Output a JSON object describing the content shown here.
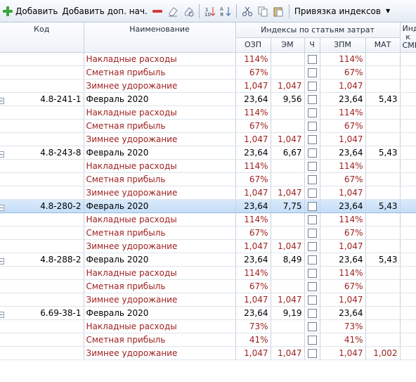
{
  "toolbar": {
    "add": "Добавить",
    "add_extra": "Добавить доп. нач.",
    "binding": "Привязка индексов"
  },
  "headers": {
    "code": "Код",
    "name": "Наименование",
    "group": "Индексы по статьям затрат",
    "ozp": "ОЗП",
    "em": "ЭМ",
    "ch": "Ч",
    "zpm": "ЗПМ",
    "mat": "МАТ",
    "cmr": "Индекс к СМР"
  },
  "rows": [
    {
      "type": "sub",
      "name": "Накладные расходы",
      "ozp": "114%",
      "em": "",
      "zpm": "114%",
      "mat": ""
    },
    {
      "type": "sub",
      "name": "Сметная прибыль",
      "ozp": "67%",
      "em": "",
      "zpm": "67%",
      "mat": ""
    },
    {
      "type": "sub",
      "name": "Зимнее удорожание",
      "ozp": "1,047",
      "em": "1,047",
      "zpm": "1,047",
      "mat": ""
    },
    {
      "type": "main",
      "code": "4.8-241-1",
      "name": "Февраль 2020",
      "ozp": "23,64",
      "em": "9,56",
      "zpm": "23,64",
      "mat": "5,43"
    },
    {
      "type": "sub",
      "name": "Накладные расходы",
      "ozp": "114%",
      "em": "",
      "zpm": "114%",
      "mat": ""
    },
    {
      "type": "sub",
      "name": "Сметная прибыль",
      "ozp": "67%",
      "em": "",
      "zpm": "67%",
      "mat": ""
    },
    {
      "type": "sub",
      "name": "Зимнее удорожание",
      "ozp": "1,047",
      "em": "1,047",
      "zpm": "1,047",
      "mat": ""
    },
    {
      "type": "main",
      "code": "4.8-243-8",
      "name": "Февраль 2020",
      "ozp": "23,64",
      "em": "6,67",
      "zpm": "23,64",
      "mat": "5,43"
    },
    {
      "type": "sub",
      "name": "Накладные расходы",
      "ozp": "114%",
      "em": "",
      "zpm": "114%",
      "mat": ""
    },
    {
      "type": "sub",
      "name": "Сметная прибыль",
      "ozp": "67%",
      "em": "",
      "zpm": "67%",
      "mat": ""
    },
    {
      "type": "sub",
      "name": "Зимнее удорожание",
      "ozp": "1,047",
      "em": "1,047",
      "zpm": "1,047",
      "mat": ""
    },
    {
      "type": "main",
      "selected": true,
      "code": "4.8-280-2",
      "name": "Февраль 2020",
      "ozp": "23,64",
      "em": "7,75",
      "zpm": "23,64",
      "mat": "5,43"
    },
    {
      "type": "sub",
      "name": "Накладные расходы",
      "ozp": "114%",
      "em": "",
      "zpm": "114%",
      "mat": ""
    },
    {
      "type": "sub",
      "name": "Сметная прибыль",
      "ozp": "67%",
      "em": "",
      "zpm": "67%",
      "mat": ""
    },
    {
      "type": "sub",
      "name": "Зимнее удорожание",
      "ozp": "1,047",
      "em": "1,047",
      "zpm": "1,047",
      "mat": ""
    },
    {
      "type": "main",
      "code": "4.8-288-2",
      "name": "Февраль 2020",
      "ozp": "23,64",
      "em": "8,49",
      "zpm": "23,64",
      "mat": "5,43"
    },
    {
      "type": "sub",
      "name": "Накладные расходы",
      "ozp": "114%",
      "em": "",
      "zpm": "114%",
      "mat": ""
    },
    {
      "type": "sub",
      "name": "Сметная прибыль",
      "ozp": "67%",
      "em": "",
      "zpm": "67%",
      "mat": ""
    },
    {
      "type": "sub",
      "name": "Зимнее удорожание",
      "ozp": "1,047",
      "em": "1,047",
      "zpm": "1,047",
      "mat": ""
    },
    {
      "type": "main",
      "code": "6.69-38-1",
      "name": "Февраль 2020",
      "ozp": "23,64",
      "em": "9,19",
      "zpm": "23,64",
      "mat": ""
    },
    {
      "type": "sub",
      "name": "Накладные расходы",
      "ozp": "73%",
      "em": "",
      "zpm": "73%",
      "mat": ""
    },
    {
      "type": "sub",
      "name": "Сметная прибыль",
      "ozp": "41%",
      "em": "",
      "zpm": "41%",
      "mat": ""
    },
    {
      "type": "sub",
      "name": "Зимнее удорожание",
      "ozp": "1,047",
      "em": "1,047",
      "zpm": "1,047",
      "mat": "1,002"
    }
  ]
}
